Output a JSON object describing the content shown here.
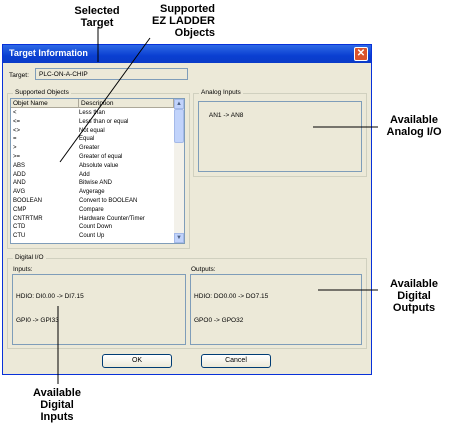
{
  "callouts": {
    "selected_target": [
      "Selected",
      "Target"
    ],
    "supported_objects": [
      "Supported",
      "EZ LADDER",
      "Objects"
    ],
    "available_analog": [
      "Available",
      "Analog I/O"
    ],
    "available_digital_outputs": [
      "Available",
      "Digital",
      "Outputs"
    ],
    "available_digital_inputs": [
      "Available",
      "Digital",
      "Inputs"
    ]
  },
  "window": {
    "title": "Target Information",
    "close_glyph": "✕"
  },
  "target": {
    "label": "Target:",
    "value": "PLC-ON-A-CHIP"
  },
  "supported_objects": {
    "group_title": "Supported Objects",
    "columns": [
      "Objet Name",
      "Description"
    ],
    "rows": [
      [
        "<",
        "Less than"
      ],
      [
        "<=",
        "Less than or equal"
      ],
      [
        "<>",
        "Not equal"
      ],
      [
        "=",
        "Equal"
      ],
      [
        ">",
        "Greater"
      ],
      [
        ">=",
        "Greater of equal"
      ],
      [
        "ABS",
        "Absolute value"
      ],
      [
        "ADD",
        "Add"
      ],
      [
        "AND",
        "Bitwise AND"
      ],
      [
        "AVG",
        "Avgerage"
      ],
      [
        "BOOLEAN",
        "Convert to BOOLEAN"
      ],
      [
        "CMP",
        "Compare"
      ],
      [
        "CNTRTMR",
        "Hardware Counter/Timer"
      ],
      [
        "CTD",
        "Count Down"
      ],
      [
        "CTU",
        "Count Up"
      ]
    ]
  },
  "analog_inputs": {
    "group_title": "Analog Inputs",
    "text": "AN1 -> AN8"
  },
  "digital_io": {
    "group_title": "Digital I/O",
    "inputs_label": "Inputs:",
    "inputs_lines": [
      "HDIO: DI0.00 -> DI7.15",
      "GPI0 -> GPI33"
    ],
    "outputs_label": "Outputs:",
    "outputs_lines": [
      "HDIO: DO0.00 -> DO7.15",
      "GPO0 -> GPO32"
    ]
  },
  "buttons": {
    "ok": "OK",
    "cancel": "Cancel"
  }
}
